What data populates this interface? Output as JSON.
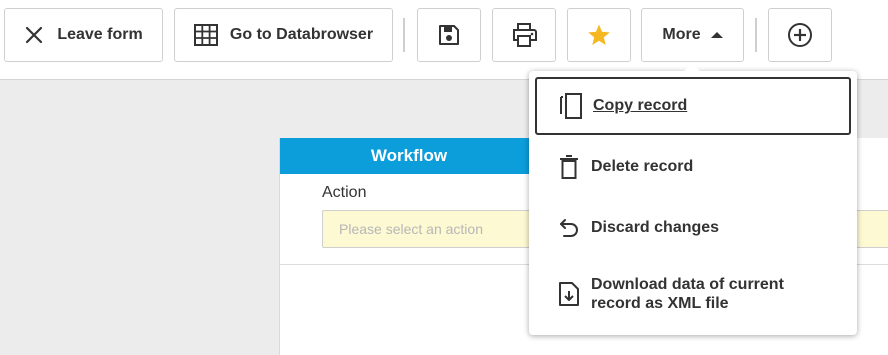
{
  "toolbar": {
    "leave_form": {
      "label": "Leave form",
      "icon": "close-icon"
    },
    "go_databrowser": {
      "label": "Go to Databrowser",
      "icon": "table-grid-icon"
    },
    "save": {
      "icon": "save-icon"
    },
    "print": {
      "icon": "print-icon"
    },
    "favorite": {
      "icon": "star-icon",
      "color": "#f5b820"
    },
    "more": {
      "label": "More",
      "icon": "caret-up-icon"
    },
    "add": {
      "icon": "plus-circle-icon"
    }
  },
  "more_menu": {
    "items": [
      {
        "label": "Copy record",
        "icon": "copy-icon",
        "active": true
      },
      {
        "label": "Delete record",
        "icon": "trash-icon"
      },
      {
        "label": "Discard changes",
        "icon": "undo-icon"
      },
      {
        "label": "Download data of current record as XML file",
        "icon": "file-download-icon"
      }
    ]
  },
  "workflow": {
    "tab_label": "Workflow",
    "action_label": "Action",
    "action_placeholder": "Please select an action",
    "header_color": "#0c9ddb"
  }
}
